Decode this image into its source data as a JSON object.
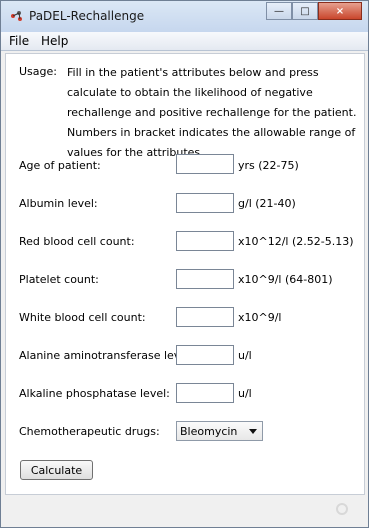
{
  "window": {
    "title": "PaDEL-Rechallenge"
  },
  "menu": [
    {
      "label": "File"
    },
    {
      "label": "Help"
    }
  ],
  "usage": {
    "label": "Usage:",
    "text": "Fill in the patient's attributes below and press calculate to obtain the likelihood of negative rechallenge and positive rechallenge for the patient. Numbers in bracket indicates the allowable range of values for the attributes."
  },
  "fields": [
    {
      "label": "Age of patient:",
      "value": "",
      "unit": "yrs (22-75)"
    },
    {
      "label": "Albumin level:",
      "value": "",
      "unit": "g/l (21-40)"
    },
    {
      "label": "Red blood cell count:",
      "value": "",
      "unit": "x10^12/l (2.52-5.13)"
    },
    {
      "label": "Platelet count:",
      "value": "",
      "unit": "x10^9/l (64-801)"
    },
    {
      "label": "White blood cell count:",
      "value": "",
      "unit": "x10^9/l"
    },
    {
      "label": "Alanine aminotransferase level:",
      "value": "",
      "unit": "u/l"
    },
    {
      "label": "Alkaline phosphatase level:",
      "value": "",
      "unit": "u/l"
    }
  ],
  "drug": {
    "label": "Chemotherapeutic drugs:",
    "selected": "Bleomycin"
  },
  "actions": {
    "calculate": "Calculate"
  },
  "titlebar_buttons": {
    "minimize": "—",
    "maximize": "□",
    "close": "×"
  }
}
